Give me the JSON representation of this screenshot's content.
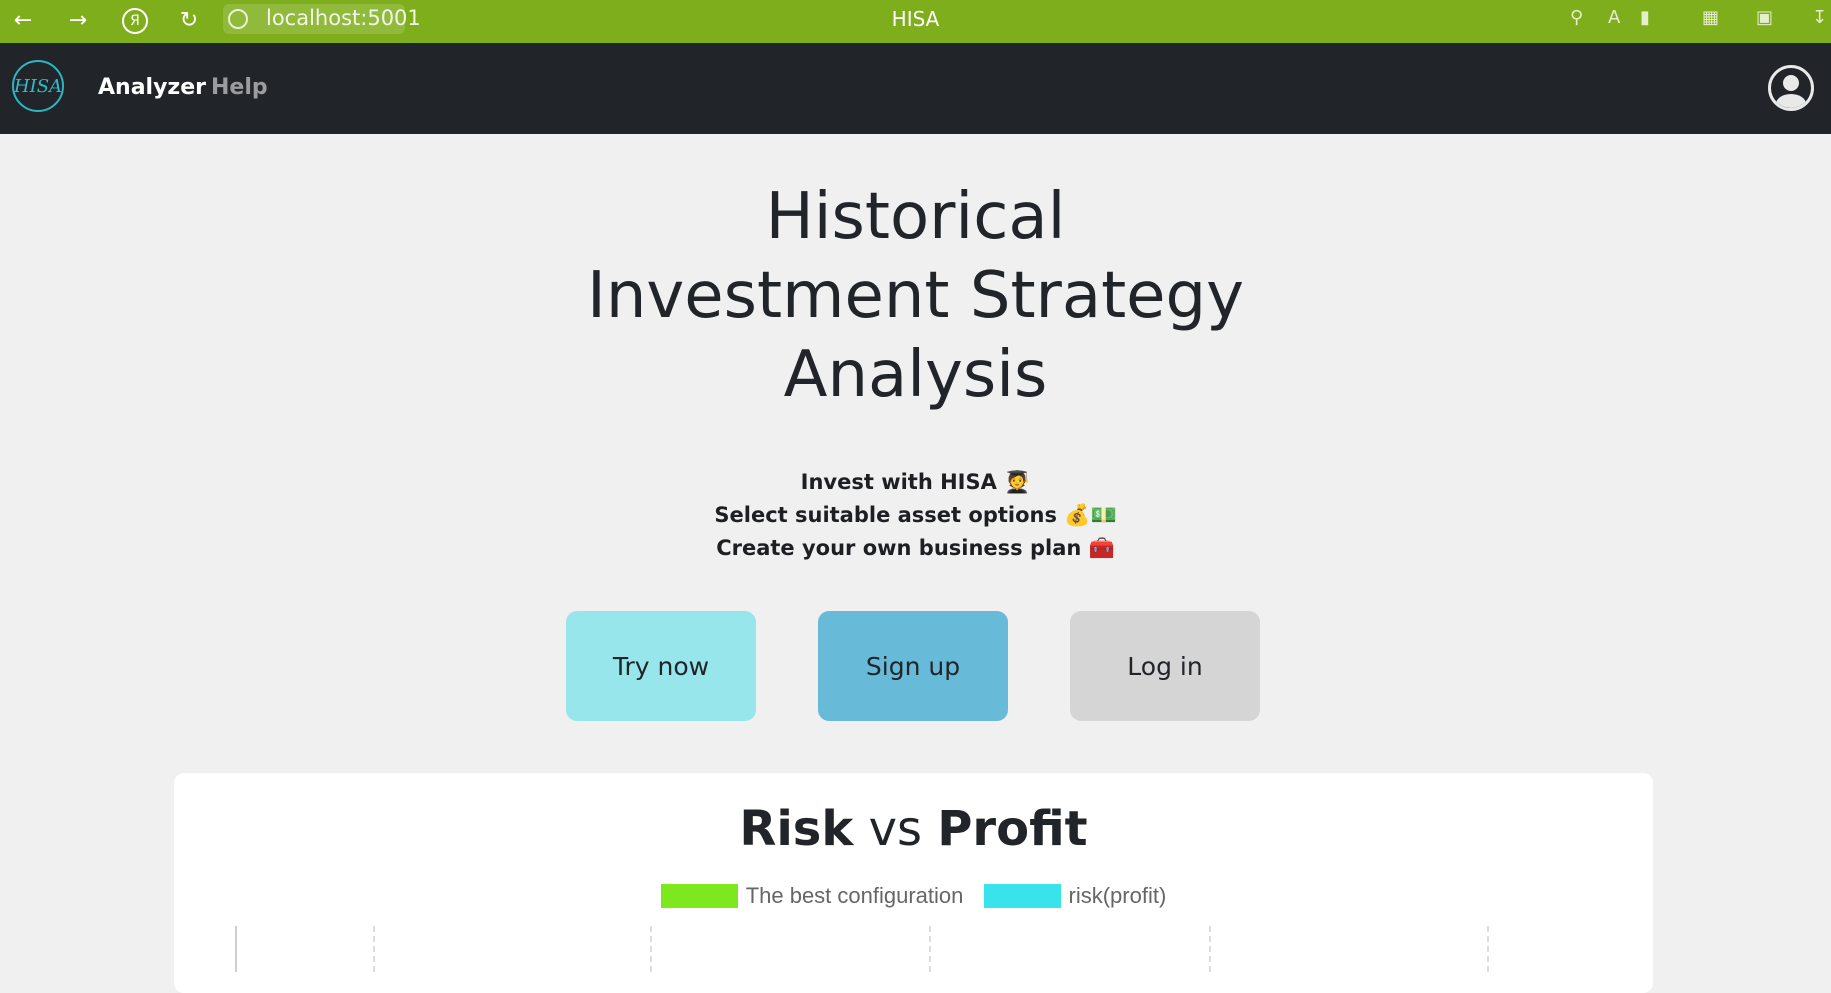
{
  "browser": {
    "url": "localhost:5001",
    "tab_title": "HISA",
    "back_icon": "arrow-left-icon",
    "forward_icon": "arrow-right-icon",
    "yandex_icon": "yandex-icon",
    "reload_icon": "reload-icon",
    "accent": "#7fae1c"
  },
  "navbar": {
    "logo_text": "HISA",
    "links": [
      "Analyzer",
      "Help"
    ],
    "background": "#212529"
  },
  "hero": {
    "title_lines": [
      "Historical",
      "Investment Strategy",
      "Analysis"
    ],
    "taglines": [
      {
        "text": "Invest with HISA",
        "emoji": "🧑‍🎓"
      },
      {
        "text": "Select suitable asset options",
        "emoji": "💰💵"
      },
      {
        "text": "Create your own business plan",
        "emoji": "🧰"
      }
    ]
  },
  "buttons": {
    "try": "Try now",
    "signup": "Sign up",
    "login": "Log in"
  },
  "chart_data": {
    "type": "scatter",
    "title_parts": [
      "Risk",
      "vs",
      "Profit"
    ],
    "legend": [
      {
        "label": "The best configuration",
        "color": "#7de81e"
      },
      {
        "label": "risk(profit)",
        "color": "#38e3ec"
      }
    ],
    "grid": true,
    "legend_position": "top"
  }
}
